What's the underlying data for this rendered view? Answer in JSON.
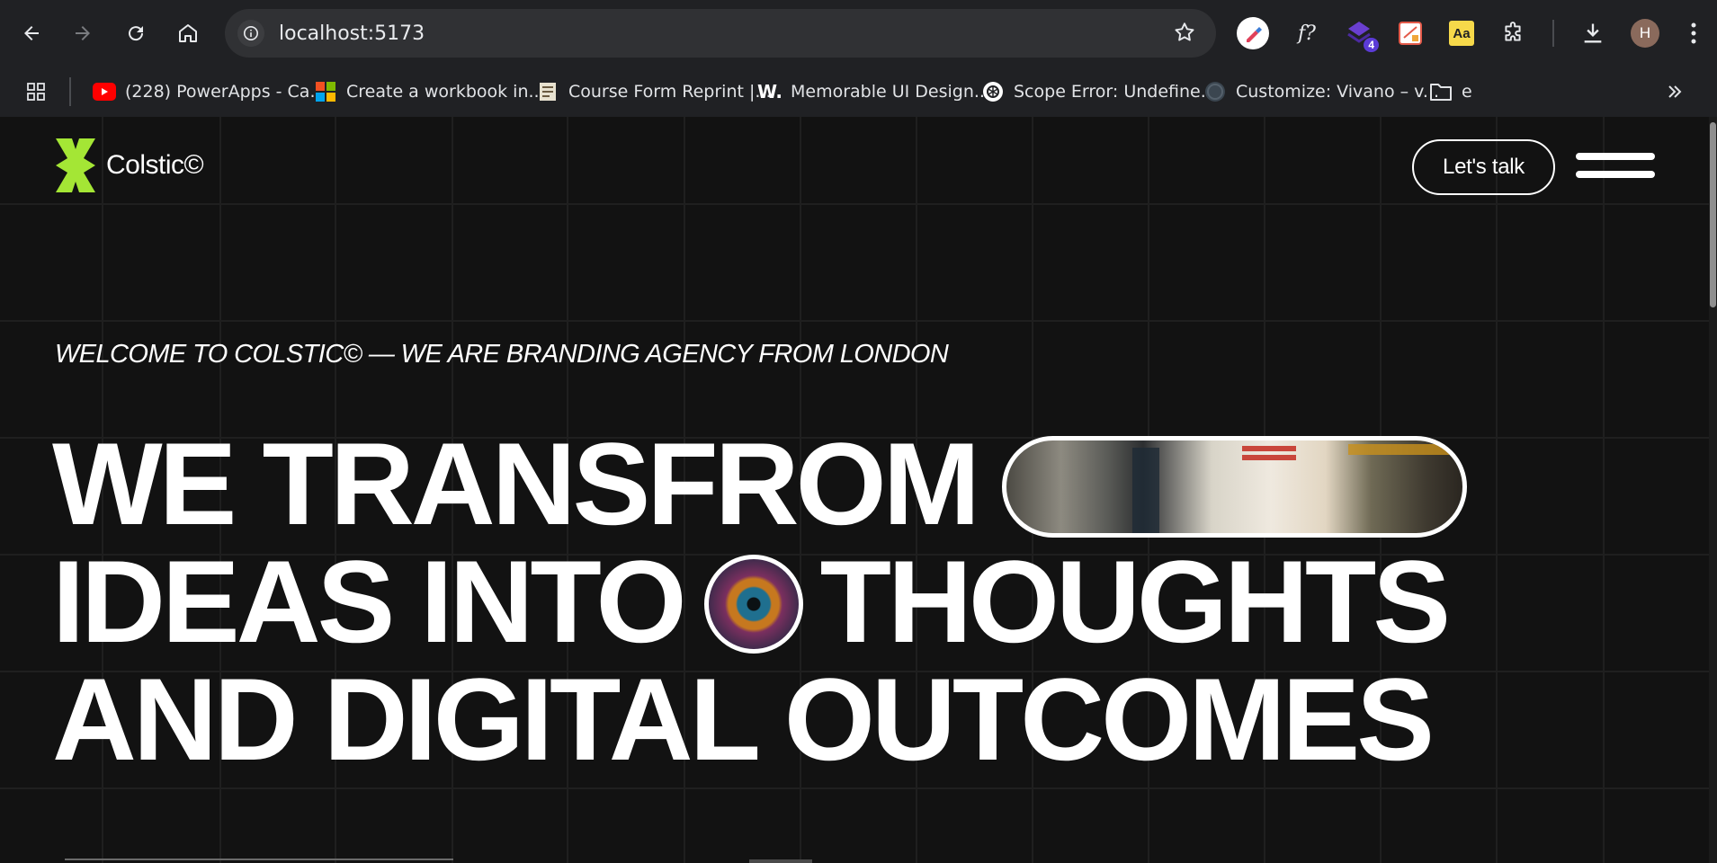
{
  "browser": {
    "url": "localhost:5173",
    "extensions": [
      {
        "name": "color-picker-extension-icon"
      },
      {
        "name": "font-finder-extension-icon",
        "label": "f?"
      },
      {
        "name": "stacked-extension-icon",
        "badge": "4"
      },
      {
        "name": "pdf-extension-icon"
      },
      {
        "name": "dictionary-extension-icon",
        "label": "Aa"
      },
      {
        "name": "puzzle-extensions-icon"
      }
    ],
    "profile_initial": "H",
    "bookmarks": [
      {
        "label": "(228) PowerApps - Ca...",
        "icon": "youtube-icon"
      },
      {
        "label": "Create a workbook in...",
        "icon": "microsoft-icon"
      },
      {
        "label": "Course Form Reprint |...",
        "icon": "document-icon"
      },
      {
        "label": "Memorable UI Design...",
        "icon": "w-logo-icon",
        "icon_text": "W."
      },
      {
        "label": "Scope Error: Undefine...",
        "icon": "openai-icon"
      },
      {
        "label": "Customize: Vivano – v...",
        "icon": "wordpress-icon"
      },
      {
        "label": "e",
        "icon": "folder-icon"
      }
    ]
  },
  "site": {
    "brand": "Colstic©",
    "cta_label": "Let's talk",
    "eyebrow": "WELCOME TO COLSTIC© — WE ARE BRANDING AGENCY FROM LONDON",
    "hero": {
      "line1": "WE TRANSFROM",
      "line2a": "IDEAS INTO",
      "line2b": "THOUGHTS",
      "line3": "AND DIGITAL OUTCOMES"
    },
    "colors": {
      "background": "#121212",
      "accent": "#a4e635",
      "text": "#ffffff"
    }
  }
}
